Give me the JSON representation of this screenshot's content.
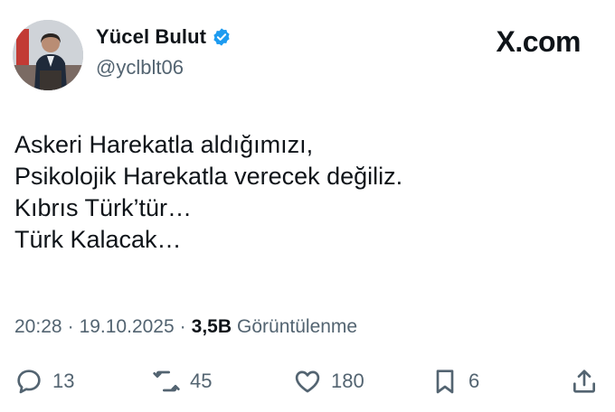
{
  "author": {
    "display_name": "Yücel Bulut",
    "handle": "@yclblt06",
    "verified": true
  },
  "brand": "X.com",
  "tweet": {
    "lines": [
      "Askeri Harekatla aldığımızı,",
      "Psikolojik Harekatla verecek değiliz.",
      "Kıbrıs Türk’tür…",
      "Türk Kalacak…"
    ]
  },
  "meta": {
    "time": "20:28",
    "date": "19.10.2025",
    "separator": "·",
    "views_count": "3,5B",
    "views_label": "Görüntülenme"
  },
  "actions": {
    "replies": "13",
    "reposts": "45",
    "likes": "180",
    "bookmarks": "6"
  },
  "colors": {
    "verified_badge": "#1d9bf0",
    "secondary_text": "#536471",
    "primary_text": "#0f1419"
  }
}
